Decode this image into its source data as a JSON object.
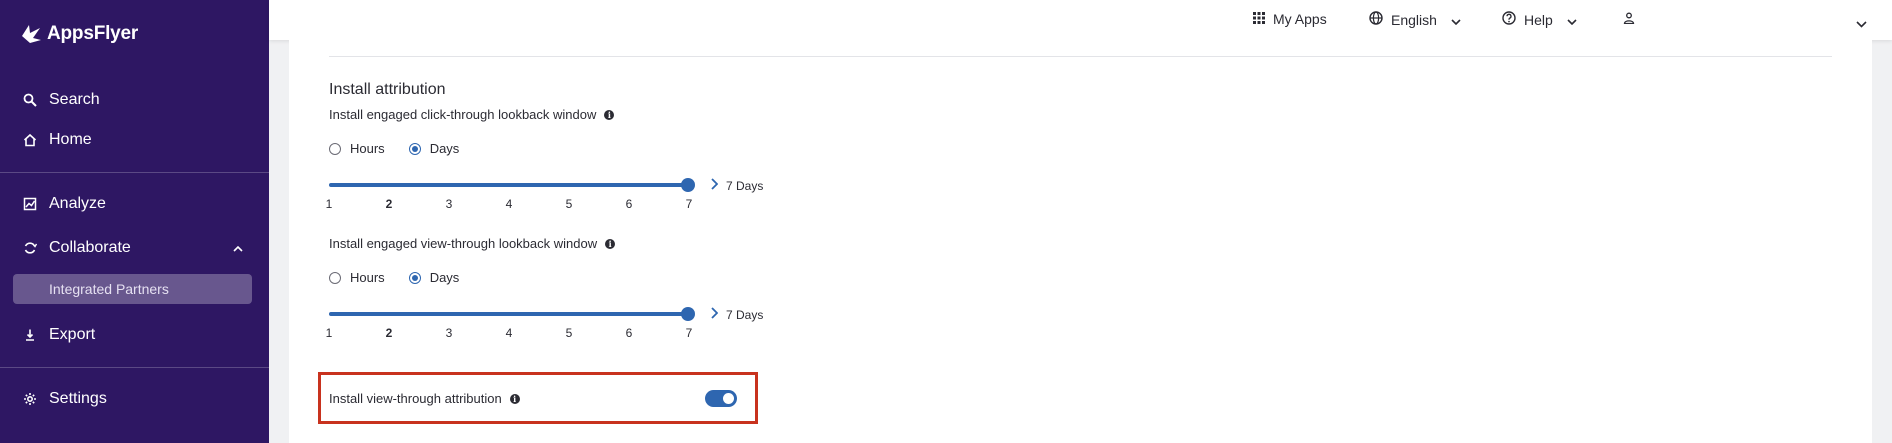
{
  "brand": {
    "name": "AppsFlyer"
  },
  "sidebar": {
    "items": [
      {
        "label": "Search",
        "icon": "search-icon"
      },
      {
        "label": "Home",
        "icon": "home-icon"
      },
      {
        "label": "Analyze",
        "icon": "analyze-icon"
      },
      {
        "label": "Collaborate",
        "icon": "collaborate-icon",
        "expanded": true
      },
      {
        "label": "Integrated Partners",
        "active": true
      },
      {
        "label": "Export",
        "icon": "export-icon"
      },
      {
        "label": "Settings",
        "icon": "gear-icon"
      }
    ]
  },
  "topbar": {
    "my_apps": "My Apps",
    "language": "English",
    "help": "Help"
  },
  "content": {
    "section_title": "Install attribution",
    "click_window": {
      "label": "Install engaged click-through lookback window",
      "options": [
        "Hours",
        "Days"
      ],
      "selected": "Days",
      "ticks": [
        "1",
        "2",
        "3",
        "4",
        "5",
        "6",
        "7"
      ],
      "value": 7,
      "value_text": "7 Days"
    },
    "view_window": {
      "label": "Install engaged view-through lookback window",
      "options": [
        "Hours",
        "Days"
      ],
      "selected": "Days",
      "ticks": [
        "1",
        "2",
        "3",
        "4",
        "5",
        "6",
        "7"
      ],
      "value": 7,
      "value_text": "7 Days"
    },
    "view_through_toggle": {
      "label": "Install view-through attribution",
      "on": true
    }
  },
  "colors": {
    "sidebar_bg": "#2e1763",
    "accent": "#2e66b0",
    "highlight_border": "#c8321e"
  }
}
